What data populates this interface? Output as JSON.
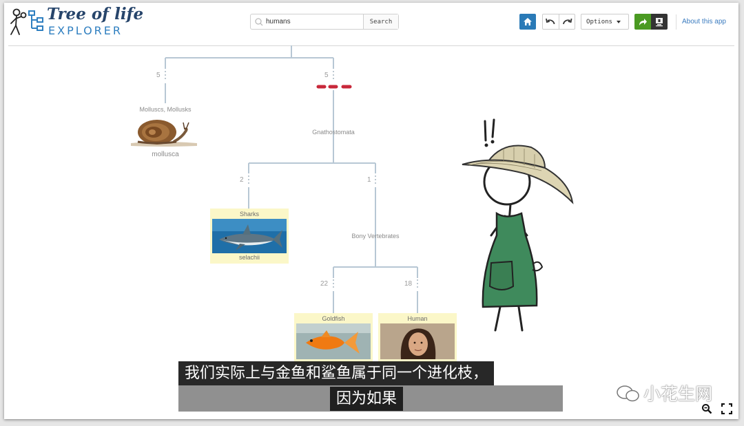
{
  "header": {
    "logo_title": "Tree of life",
    "logo_subtitle": "EXPLORER",
    "search_value": "humans",
    "search_button": "Search",
    "options_label": "Options",
    "about_label": "About this app",
    "home_color": "#2a7ab7",
    "share_color": "#4a9a22"
  },
  "tree": {
    "molluscs": {
      "count": "5",
      "common_name": "Molluscs, Mollusks",
      "latin_name": "mollusca"
    },
    "gnathostomata": {
      "count": "5",
      "label": "Gnathostomata"
    },
    "sharks": {
      "count": "2",
      "common_name": "Sharks",
      "latin_name": "selachii"
    },
    "bony": {
      "count": "1",
      "label": "Bony Vertebrates"
    },
    "goldfish": {
      "count": "22",
      "common_name": "Goldfish"
    },
    "human": {
      "count": "18",
      "common_name": "Human"
    }
  },
  "subtitles": {
    "line1": "我们实际上与金鱼和鲨鱼属于同一个进化枝，",
    "line2": "因为如果"
  },
  "watermark": "小花生网"
}
